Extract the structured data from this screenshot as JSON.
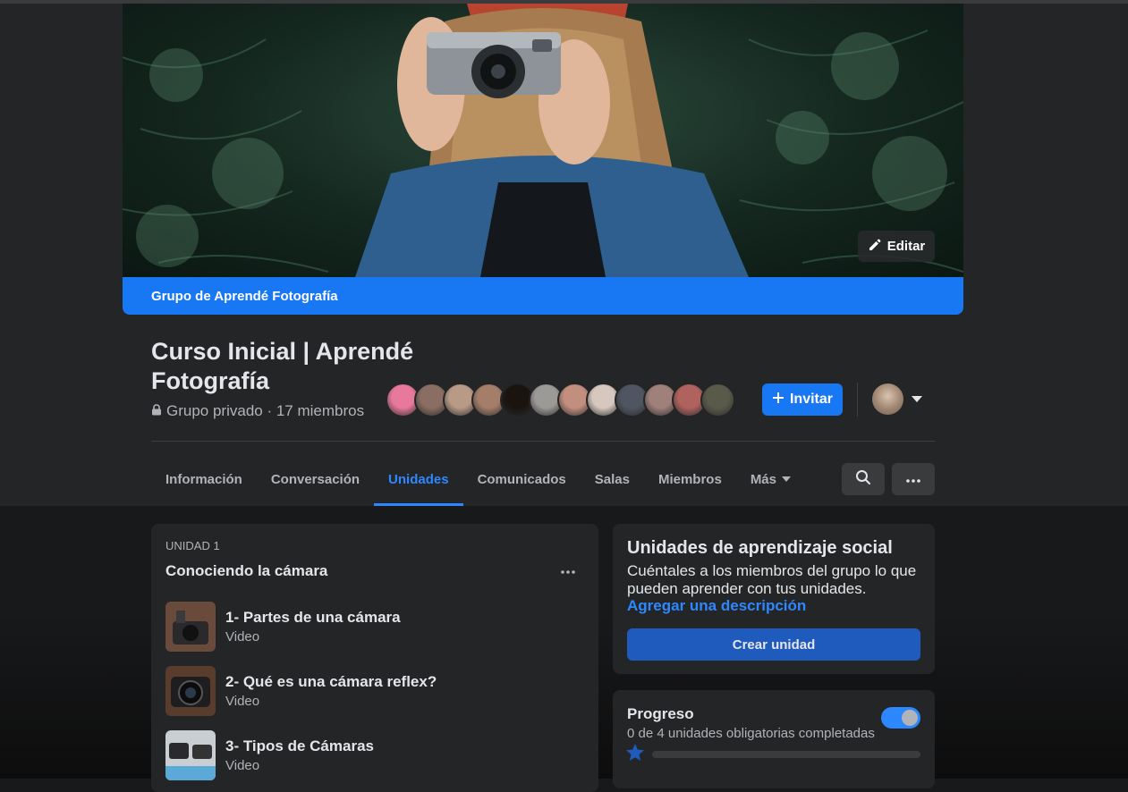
{
  "cover": {
    "edit_label": "Editar",
    "group_bar_label": "Grupo de Aprendé Fotografía"
  },
  "group": {
    "title": "Curso Inicial | Aprendé Fotografía",
    "privacy": "Grupo privado · 17 miembros",
    "invite_label": "Invitar"
  },
  "member_avatar_colors": [
    "#e8799c",
    "#8a6e63",
    "#b99a86",
    "#a57e69",
    "#1a1410",
    "#9c9a97",
    "#c28f7f",
    "#d7c8bf",
    "#4f5661",
    "#a0807a",
    "#b0625e",
    "#5a5a4a"
  ],
  "tabs": [
    {
      "label": "Información"
    },
    {
      "label": "Conversación"
    },
    {
      "label": "Unidades"
    },
    {
      "label": "Comunicados"
    },
    {
      "label": "Salas"
    },
    {
      "label": "Miembros"
    },
    {
      "label": "Más"
    }
  ],
  "active_tab": "Unidades",
  "unit": {
    "label": "UNIDAD 1",
    "title": "Conociendo la cámara",
    "lessons": [
      {
        "title": "1- Partes de una cámara",
        "type": "Video"
      },
      {
        "title": "2- Qué es una cámara reflex?",
        "type": "Video"
      },
      {
        "title": "3- Tipos de Cámaras",
        "type": "Video"
      }
    ]
  },
  "social": {
    "title": "Unidades de aprendizaje social",
    "description": "Cuéntales a los miembros del grupo lo que pueden aprender con tus unidades.",
    "link": "Agregar una descripción",
    "create_label": "Crear unidad"
  },
  "progress": {
    "title": "Progreso",
    "subtitle": "0 de 4 unidades obligatorias completadas",
    "completed_fraction": 0,
    "toggle_on": true
  },
  "colors": {
    "accent": "#1877f2",
    "link": "#2d88ff",
    "surface": "#242526",
    "background": "#18191a"
  }
}
